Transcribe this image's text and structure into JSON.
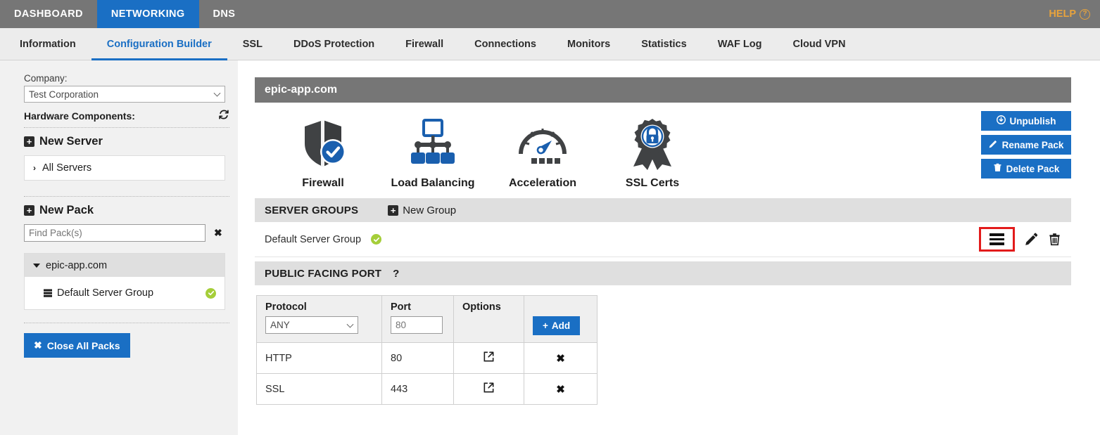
{
  "topnav": {
    "items": [
      {
        "label": "DASHBOARD",
        "active": false
      },
      {
        "label": "NETWORKING",
        "active": true
      },
      {
        "label": "DNS",
        "active": false
      }
    ],
    "help_label": "HELP",
    "help_icon": "question-circle-icon"
  },
  "subnav": {
    "items": [
      {
        "label": "Information",
        "active": false
      },
      {
        "label": "Configuration Builder",
        "active": true
      },
      {
        "label": "SSL",
        "active": false
      },
      {
        "label": "DDoS Protection",
        "active": false
      },
      {
        "label": "Firewall",
        "active": false
      },
      {
        "label": "Connections",
        "active": false
      },
      {
        "label": "Monitors",
        "active": false
      },
      {
        "label": "Statistics",
        "active": false
      },
      {
        "label": "WAF Log",
        "active": false
      },
      {
        "label": "Cloud VPN",
        "active": false
      }
    ]
  },
  "sidebar": {
    "company_label": "Company:",
    "company_value": "Test Corporation",
    "hardware_label": "Hardware Components:",
    "refresh_icon": "refresh-icon",
    "new_server_label": "New Server",
    "all_servers_label": "All Servers",
    "new_pack_label": "New Pack",
    "find_pack_placeholder": "Find Pack(s)",
    "find_pack_value": "",
    "clear_icon": "clear-x-icon",
    "pack_name": "epic-app.com",
    "pack_group_name": "Default Server Group",
    "pack_group_status": "online",
    "close_all_label": "Close All Packs"
  },
  "panel": {
    "title": "epic-app.com",
    "features": [
      {
        "label": "Firewall",
        "icon": "shield-check-icon"
      },
      {
        "label": "Load Balancing",
        "icon": "load-balancer-icon"
      },
      {
        "label": "Acceleration",
        "icon": "speedometer-icon"
      },
      {
        "label": "SSL Certs",
        "icon": "certificate-lock-icon"
      }
    ],
    "actions": [
      {
        "label": "Unpublish",
        "icon": "unpublish-icon"
      },
      {
        "label": "Rename Pack",
        "icon": "pencil-icon"
      },
      {
        "label": "Delete Pack",
        "icon": "trash-icon"
      }
    ],
    "server_groups": {
      "section_title": "SERVER GROUPS",
      "new_group_label": "New Group",
      "rows": [
        {
          "name": "Default Server Group",
          "status": "online",
          "actions": [
            "list-icon",
            "pencil-icon",
            "trash-icon"
          ],
          "highlighted_action": "list-icon"
        }
      ]
    },
    "public_facing_port": {
      "section_title": "PUBLIC FACING PORT",
      "help_label": "?",
      "columns": [
        "Protocol",
        "Port",
        "Options",
        ""
      ],
      "new_row": {
        "protocol_value": "ANY",
        "port_placeholder": "80",
        "port_value": "",
        "add_label": "Add"
      },
      "rows": [
        {
          "protocol": "HTTP",
          "port": "80",
          "options_icon": "external-link-icon",
          "remove_icon": "x-icon"
        },
        {
          "protocol": "SSL",
          "port": "443",
          "options_icon": "external-link-icon",
          "remove_icon": "x-icon"
        }
      ]
    }
  },
  "colors": {
    "accent_blue": "#1a6fc4",
    "topbar_gray": "#767676",
    "status_green": "#a5ce39",
    "highlight_red": "#e21b1b",
    "help_orange": "#e8a33d"
  }
}
